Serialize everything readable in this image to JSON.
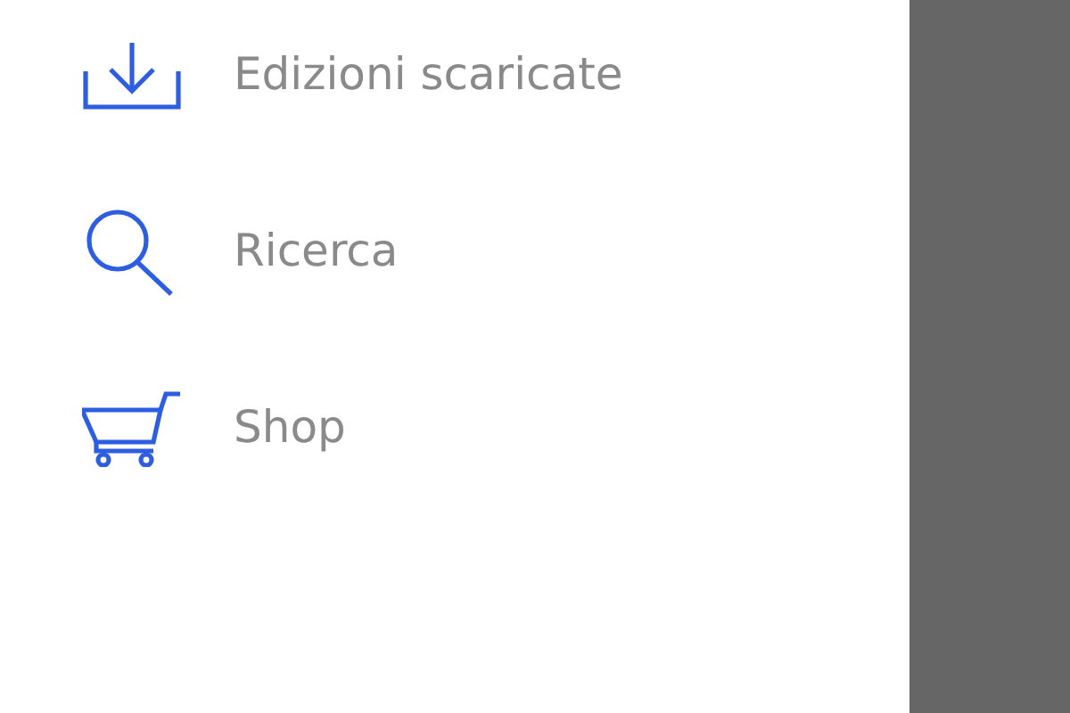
{
  "menu": {
    "items": [
      {
        "kind": "download",
        "label": "Edizioni scaricate"
      },
      {
        "kind": "search",
        "label": "Ricerca"
      },
      {
        "kind": "cart",
        "label": "Shop"
      }
    ]
  }
}
